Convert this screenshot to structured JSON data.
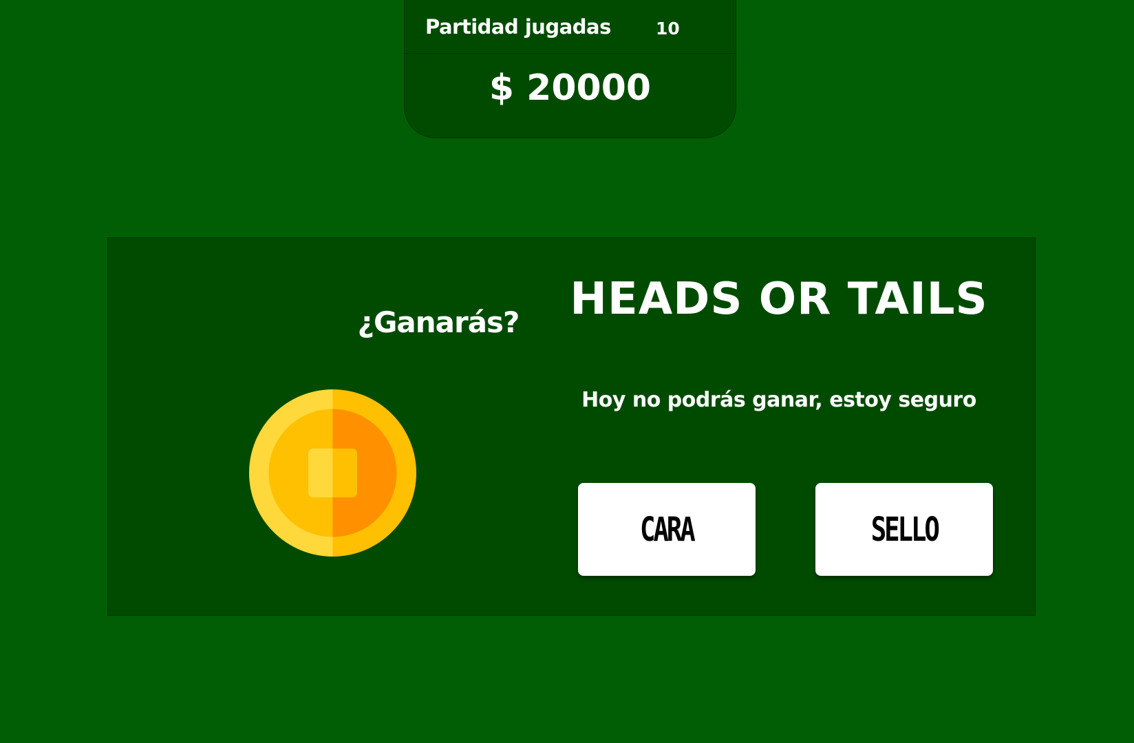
{
  "stats": {
    "games_played_label": "Partidad jugadas",
    "games_played_count": "10",
    "balance": "$ 20000"
  },
  "game": {
    "question": "¿Ganarás?",
    "title": "HEADS OR TAILS",
    "taunt": "Hoy no podrás ganar, estoy seguro",
    "heads_button": "CARA",
    "tails_button": "SELLO",
    "coin_icon": "coin-icon"
  },
  "colors": {
    "background": "#025e04",
    "panel": "#014b01",
    "border": "#003400",
    "coin_light": "#ffd83b",
    "coin_mid": "#ffc001",
    "coin_dark": "#ff9100",
    "button": "#ffffff",
    "text": "#ffffff"
  }
}
